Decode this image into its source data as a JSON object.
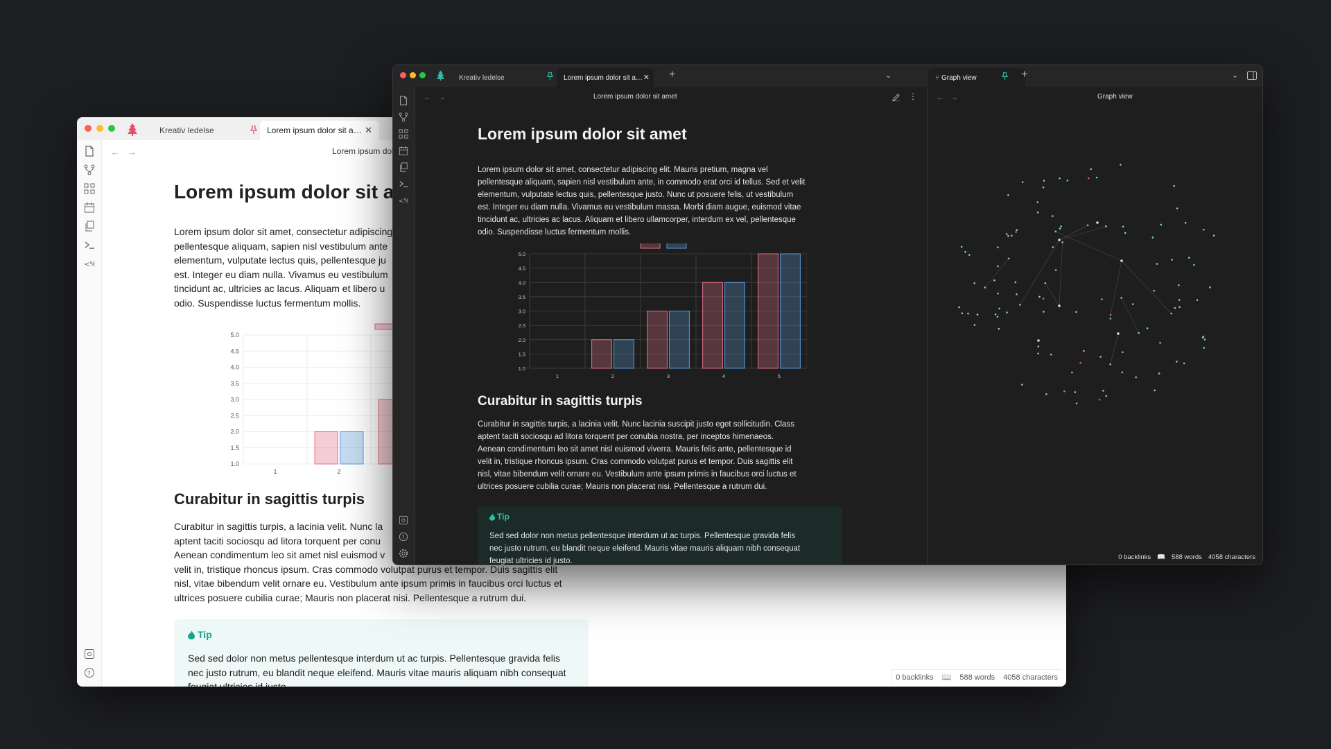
{
  "app": {
    "tabs": {
      "vault_name": "Kreativ ledelse",
      "note_tab": "Lorem ipsum dolor sit a…",
      "graph_tab": "Graph view"
    },
    "view_title": "Lorem ipsum dolor sit amet",
    "graph_title": "Graph view"
  },
  "light_window": {
    "view_title_partial": "Lorem ipsum dol",
    "heading_partial": "Lorem ipsum dolor sit am",
    "para1_lines": [
      "Lorem ipsum dolor sit amet, consectetur adipiscing",
      "pellentesque aliquam, sapien nisl vestibulum ante",
      "elementum, vulputate lectus quis, pellentesque ju",
      "est. Integer eu diam nulla. Vivamus eu vestibulum",
      "tincidunt ac, ultricies ac lacus. Aliquam et libero u",
      "odio. Suspendisse luctus fermentum mollis."
    ],
    "subheading": "Curabitur in sagittis turpis",
    "para2_lines": [
      "Curabitur in sagittis turpis, a lacinia velit. Nunc la",
      "aptent taciti sociosqu ad litora torquent per conu",
      "Aenean condimentum leo sit amet nisl euismod v",
      "velit in, tristique rhoncus ipsum. Cras commodo volutpat purus et tempor. Duis sagittis elit",
      "nisl, vitae bibendum velit ornare eu. Vestibulum ante ipsum primis in faucibus orci luctus et",
      "ultrices posuere cubilia curae; Mauris non placerat nisi. Pellentesque a rutrum dui."
    ],
    "callout_title": "Tip",
    "callout_lines": [
      "Sed sed dolor non metus pellentesque interdum ut ac turpis. Pellentesque gravida felis",
      "nec justo rutrum, eu blandit neque eleifend. Mauris vitae mauris aliquam nibh consequat",
      "feugiat ultricies id justo."
    ],
    "status": {
      "backlinks": "0 backlinks",
      "words": "588 words",
      "characters": "4058 characters"
    }
  },
  "dark_window": {
    "heading": "Lorem ipsum dolor sit amet",
    "para1_lines": [
      "Lorem ipsum dolor sit amet, consectetur adipiscing elit. Mauris pretium, magna vel",
      "pellentesque aliquam, sapien nisl vestibulum ante, in commodo erat orci id tellus. Sed et velit",
      "elementum, vulputate lectus quis, pellentesque justo. Nunc ut posuere felis, ut vestibulum",
      "est. Integer eu diam nulla. Vivamus eu vestibulum massa. Morbi diam augue, euismod vitae",
      "tincidunt ac, ultricies ac lacus. Aliquam et libero ullamcorper, interdum ex vel, pellentesque",
      "odio. Suspendisse luctus fermentum mollis."
    ],
    "subheading": "Curabitur in sagittis turpis",
    "para2_lines": [
      "Curabitur in sagittis turpis, a lacinia velit. Nunc lacinia suscipit justo eget sollicitudin. Class",
      "aptent taciti sociosqu ad litora torquent per conubia nostra, per inceptos himenaeos.",
      "Aenean condimentum leo sit amet nisl euismod viverra. Mauris felis ante, pellentesque id",
      "velit in, tristique rhoncus ipsum. Cras commodo volutpat purus et tempor. Duis sagittis elit",
      "nisl, vitae bibendum velit ornare eu. Vestibulum ante ipsum primis in faucibus orci luctus et",
      "ultrices posuere cubilia curae; Mauris non placerat nisi. Pellentesque a rutrum dui."
    ],
    "callout_title": "Tip",
    "callout_lines": [
      "Sed sed dolor non metus pellentesque interdum ut ac turpis. Pellentesque gravida felis",
      "nec justo rutrum, eu blandit neque eleifend. Mauris vitae mauris aliquam nibh consequat",
      "feugiat ultricies id justo."
    ],
    "status": {
      "backlinks": "0 backlinks",
      "words": "588 words",
      "characters": "4058 characters"
    }
  },
  "icons": {
    "sidebar": [
      "open-file-icon",
      "branch-icon",
      "grid-icon",
      "calendar-icon",
      "copy-icon",
      "terminal-icon",
      "code-icon"
    ],
    "sidebar_bottom": [
      "vault-icon",
      "help-icon",
      "settings-icon"
    ]
  },
  "colors": {
    "series_a": "#e0708a",
    "series_b": "#5b9bd5",
    "accent": "#14a58a",
    "graph_node": "#7fd1c0"
  },
  "chart_data": [
    {
      "type": "bar",
      "categories": [
        "1",
        "2",
        "3",
        "4",
        "5"
      ],
      "series": [
        {
          "values": [
            1,
            2,
            3,
            4,
            5
          ]
        },
        {
          "values": [
            1,
            2,
            3,
            4,
            5
          ]
        }
      ],
      "ylim": [
        1,
        5
      ],
      "yticks": [
        "1.0",
        "1.5",
        "2.0",
        "2.5",
        "3.0",
        "3.5",
        "4.0",
        "4.5",
        "5.0"
      ],
      "grid": true,
      "legend": "top"
    }
  ]
}
